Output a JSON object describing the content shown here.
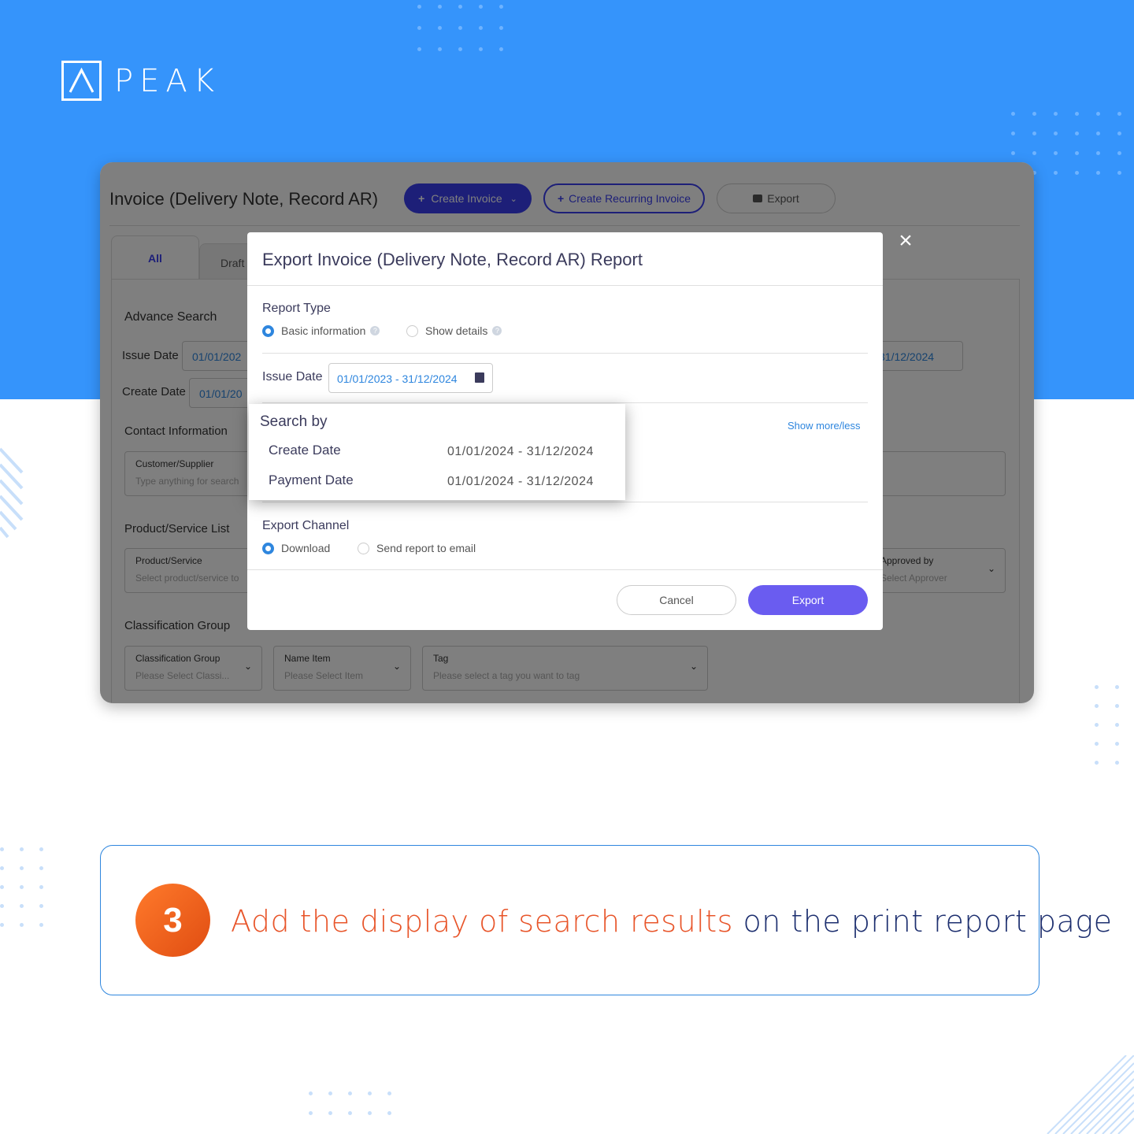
{
  "brand": {
    "name": "PEAK"
  },
  "app": {
    "page_title": "Invoice (Delivery Note, Record AR)",
    "buttons": {
      "create_invoice": "Create Invoice",
      "create_recurring": "Create Recurring Invoice",
      "export": "Export"
    },
    "tabs": [
      "All",
      "Draft"
    ],
    "advance_search": "Advance Search",
    "issue_date_label": "Issue Date",
    "issue_date_value": "01/01/202",
    "issue_date_end": "31/12/2024",
    "create_date_label": "Create Date",
    "create_date_value": "01/01/20",
    "contact_information": "Contact Information",
    "customer_supplier": {
      "title": "Customer/Supplier",
      "placeholder": "Type anything for search"
    },
    "product_service_list": "Product/Service List",
    "product_service": {
      "title": "Product/Service",
      "placeholder": "Select product/service to"
    },
    "approved_by": {
      "title": "Approved by",
      "placeholder": "Select Approver"
    },
    "classification_group_label": "Classification Group",
    "classification_group": {
      "title": "Classification Group",
      "placeholder": "Please Select Classi..."
    },
    "name_item": {
      "title": "Name Item",
      "placeholder": "Please Select Item"
    },
    "tag": {
      "title": "Tag",
      "placeholder": "Please select a tag you want to tag"
    }
  },
  "modal": {
    "title": "Export Invoice (Delivery Note, Record AR) Report",
    "report_type_label": "Report Type",
    "report_type_options": [
      "Basic information",
      "Show details"
    ],
    "report_type_selected": "Basic information",
    "issue_date_label": "Issue Date",
    "issue_date_value": "01/01/2023 - 31/12/2024",
    "show_more_less": "Show more/less",
    "export_channel_label": "Export Channel",
    "export_channel_options": [
      "Download",
      "Send report to email"
    ],
    "export_channel_selected": "Download",
    "cancel_label": "Cancel",
    "export_label": "Export"
  },
  "search_by": {
    "title": "Search by",
    "rows": [
      {
        "label": "Create Date",
        "value": "01/01/2024 - 31/12/2024"
      },
      {
        "label": "Payment Date",
        "value": "01/01/2024 - 31/12/2024"
      }
    ]
  },
  "step": {
    "number": "3",
    "highlight": "Add the display of search results",
    "rest": "on the print report page"
  },
  "colors": {
    "hero": "#3594fb",
    "primary": "#3a3ef0",
    "export_button": "#6a5cf0",
    "step_orange": "#e8552a",
    "step_navy": "#1d2f6f"
  }
}
